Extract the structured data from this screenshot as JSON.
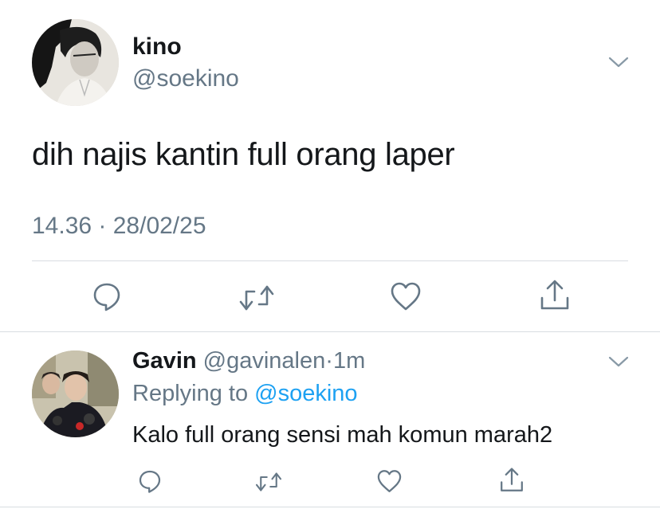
{
  "main_tweet": {
    "display_name": "kino",
    "handle": "@soekino",
    "text": "dih najis kantin full orang laper",
    "timestamp": "14.36 · 28/02/25",
    "actions": {
      "reply_icon": "reply-icon",
      "retweet_icon": "retweet-icon",
      "like_icon": "heart-icon",
      "share_icon": "share-icon"
    }
  },
  "reply": {
    "display_name": "Gavin",
    "handle": "@gavinalen",
    "separator": "·",
    "time": "1m",
    "replying_prefix": "Replying to ",
    "replying_mention": "@soekino",
    "text": "Kalo full orang sensi mah komun marah2",
    "actions": {
      "reply_icon": "reply-icon",
      "retweet_icon": "retweet-icon",
      "like_icon": "heart-icon",
      "share_icon": "share-icon"
    }
  },
  "colors": {
    "text_primary": "#14171a",
    "text_secondary": "#657786",
    "link": "#1da1f2",
    "icon": "#657786",
    "divider": "#d8dde1"
  }
}
